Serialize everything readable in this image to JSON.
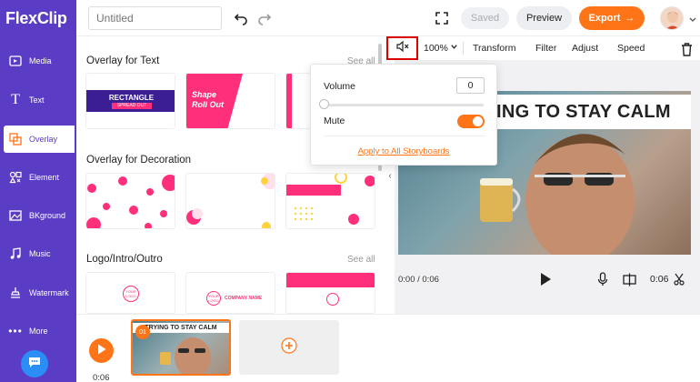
{
  "app": {
    "logo_text": "FlexClip",
    "brand_color": "#5b3cc4",
    "accent_color": "#ff7416"
  },
  "header": {
    "title_placeholder": "Untitled",
    "saved_label": "Saved",
    "preview_label": "Preview",
    "export_label": "Export"
  },
  "sidebar": {
    "items": [
      {
        "label": "Media",
        "icon": "media-icon"
      },
      {
        "label": "Text",
        "icon": "text-icon"
      },
      {
        "label": "Overlay",
        "icon": "overlay-icon",
        "active": true
      },
      {
        "label": "Element",
        "icon": "element-icon"
      },
      {
        "label": "BKground",
        "icon": "background-icon"
      },
      {
        "label": "Music",
        "icon": "music-icon"
      },
      {
        "label": "Watermark",
        "icon": "watermark-icon"
      },
      {
        "label": "More",
        "icon": "more-icon"
      }
    ]
  },
  "panel": {
    "sections": [
      {
        "title": "Overlay for Text",
        "see_all": "See all"
      },
      {
        "title": "Overlay for Decoration"
      },
      {
        "title": "Logo/Intro/Outro",
        "see_all": "See all"
      }
    ],
    "text_thumbs": {
      "rectangle_title": "RECTANGLE",
      "rectangle_sub": "SPREAD OUT",
      "shape_line1": "Shape",
      "shape_line2": "Roll Out"
    },
    "logo_thumbs": {
      "logo_text": "YOUR LOGO",
      "company_name": "COMPANY NAME"
    }
  },
  "toolbar": {
    "zoom": "100%",
    "transform_label": "Transform",
    "filter_label": "Filter",
    "adjust_label": "Adjust",
    "speed_label": "Speed"
  },
  "volume_popup": {
    "volume_label": "Volume",
    "volume_value": "0",
    "mute_label": "Mute",
    "mute_on": true,
    "apply_label": "Apply to All Storyboards"
  },
  "preview": {
    "video_title": "ING TO STAY CALM",
    "time_current": "0:00 / 0:06",
    "duration": "0:06"
  },
  "timeline": {
    "time": "0:06",
    "clip_number": "01",
    "clip_title": "TRYING TO STAY CALM"
  }
}
